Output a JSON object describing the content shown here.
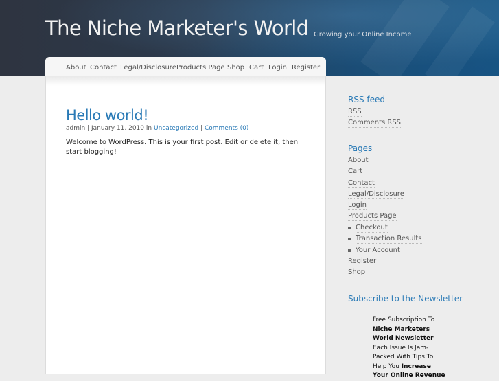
{
  "header": {
    "site_title": "The Niche Marketer's World",
    "tagline": "Growing your Online Income"
  },
  "nav": {
    "items": [
      {
        "label": "About"
      },
      {
        "label": "Contact"
      },
      {
        "label": "Legal/Disclosure"
      },
      {
        "label": "Products Page"
      },
      {
        "label": "Shop"
      },
      {
        "label": "Cart"
      },
      {
        "label": "Login"
      },
      {
        "label": "Register"
      }
    ]
  },
  "post": {
    "title": "Hello world!",
    "author": "admin",
    "date": "January 11, 2010",
    "in_word": "in",
    "category": "Uncategorized",
    "comments": "Comments (0)",
    "body": "Welcome to WordPress. This is your first post. Edit or delete it, then start blogging!"
  },
  "sidebar": {
    "rss_heading": "RSS feed",
    "rss_links": [
      "RSS",
      "Comments RSS"
    ],
    "pages_heading": "Pages",
    "pages": [
      "About",
      "Cart",
      "Contact",
      "Legal/Disclosure",
      "Login",
      "Products Page"
    ],
    "subpages": [
      "Checkout",
      "Transaction Results",
      "Your Account"
    ],
    "pages_after": [
      "Register",
      "Shop"
    ],
    "newsletter_heading": "Subscribe to the Newsletter",
    "newsletter": {
      "line1": "Free Subscription To",
      "bold1": "Niche Marketers World Newsletter",
      "line2": "Each Issue Is Jam-Packed With Tips To Help You",
      "bold2": "Increase Your Online Revenue"
    }
  },
  "colors": {
    "link": "#2a7ab6",
    "header_dark": "#2e3440",
    "header_blue": "#1b5884"
  }
}
